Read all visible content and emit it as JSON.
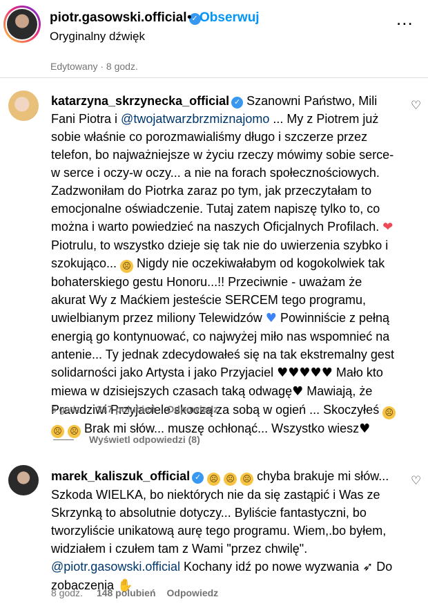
{
  "header": {
    "username": "piotr.gasowski.official",
    "dot": "•",
    "follow_label": "Obserwuj",
    "subtitle": "Oryginalny dźwięk",
    "more_label": "..."
  },
  "post_meta": "Edytowany · 8 godz.",
  "comments": [
    {
      "username": "katarzyna_skrzynecka_official",
      "t1": " Szanowni Państwo, Mili Fani Piotra i ",
      "mention": "@twojatwarzbrzmiznajomo",
      "t2": " ... My z Piotrem już sobie właśnie co porozmawialiśmy długo i szczerze przez telefon, bo najważniejsze w życiu rzeczy mówimy sobie serce-w serce i oczy-w oczy... a nie na forach społecznościowych. Zadzwoniłam do Piotrka zaraz po tym, jak przeczytałam to emocjonalne oświadczenie. Tutaj zatem napiszę tylko to, co można i warto powiedzieć na naszych Oficjalnych Profilach. ",
      "e1": "❤",
      "t3": "Piotrulu, to wszystko dzieje się tak nie do uwierzenia szybko i szokująco... ",
      "e2": "😢",
      "t4": " Nigdy nie oczekiwałabym od kogokolwiek tak bohaterskiego gestu Honoru...!! Przeciwnie - uważam że akurat Wy z Maćkiem jesteście SERCEM tego programu, uwielbianym przez miliony Telewidzów ",
      "e3": "♥",
      "t5": " Powinniście z pełną energią go kontynuować, co najwyżej miło nas wspomnieć na antenie... Ty jednak zdecydowałeś się na tak ekstremalny gest solidarności jako Artysta i jako Przyjaciel ",
      "e4": "♥♥♥♥♥",
      "t6": " Mało kto miewa w dzisiejszych czasach taką odwagę",
      "e5": "♥",
      "t7": " Mawiają, że Prawdziwi Przyjaciele skoczą za sobą w ogień ... Skoczyłeś ",
      "e6": "😢😢😢",
      "t8": " Brak mi słów... muszę ochłonąć... Wszystko wiesz",
      "e7": "♥",
      "time": "5 godz.",
      "likes": "317 polubień",
      "reply": "Odpowiedz"
    },
    {
      "username": "marek_kaliszuk_official",
      "e1": "😢😢😢",
      "t1": " chyba brakuje mi słów... Szkoda WIELKA, bo niektórych nie da się zastąpić i Was ze Skrzynką to absolutnie dotyczy... Byliście fantastyczni, bo tworzyliście unikatową aurę tego programu. Wiem,.bo byłem, widziałem i czułem tam z Wami \"przez chwilę\". ",
      "mention": "@piotr.gasowski.official",
      "t2": " Kochany idź po nowe wyzwania ",
      "e2": "🚀",
      "t3": " Do zobaczenia ",
      "e3": "🙌",
      "time": "8 godz.",
      "likes": "148 polubień",
      "reply": "Odpowiedz"
    }
  ],
  "view_replies": "Wyświetl odpowiedzi (8)",
  "like_icon": "♡",
  "verified_icon": "✓",
  "colors": {
    "accent": "#0095f6",
    "mention": "#00376b",
    "meta": "#737373",
    "verified": "#3897f0",
    "heart_red": "#ed4956",
    "heart_blue": "#3f83f8"
  }
}
